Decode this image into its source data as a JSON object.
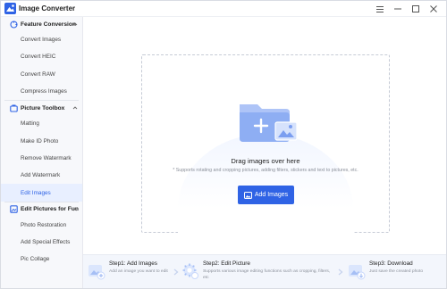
{
  "app": {
    "title": "Image Converter"
  },
  "sidebar": {
    "groups": [
      {
        "label": "Feature Conversion",
        "items": [
          "Convert Images",
          "Convert HEIC",
          "Convert RAW",
          "Compress Images"
        ]
      },
      {
        "label": "Picture Toolbox",
        "items": [
          "Matting",
          "Make ID Photo",
          "Remove Watermark",
          "Add Watermark",
          "Edit Images"
        ]
      },
      {
        "label": "Edit Pictures for Fun",
        "items": [
          "Photo Restoration",
          "Add Special Effects",
          "Pic Collage"
        ]
      }
    ],
    "active_item": "Edit Images"
  },
  "main": {
    "drag_title": "Drag images over here",
    "drag_subtitle": "* Supports rotating and cropping pictures, adding filters, stickers and text to pictures, etc.",
    "add_button": "Add Images"
  },
  "steps": [
    {
      "title": "Step1:  Add Images",
      "desc": "Add an image you want to edit"
    },
    {
      "title": "Step2:  Edit Picture",
      "desc": "Supports various image editing functions such as cropping, filters, etc"
    },
    {
      "title": "Step3:  Download",
      "desc": "Just save the created photo"
    }
  ],
  "colors": {
    "accent": "#2f63e5",
    "active_bg": "#e8efff",
    "sidebar_bg": "#f7f8fb"
  }
}
